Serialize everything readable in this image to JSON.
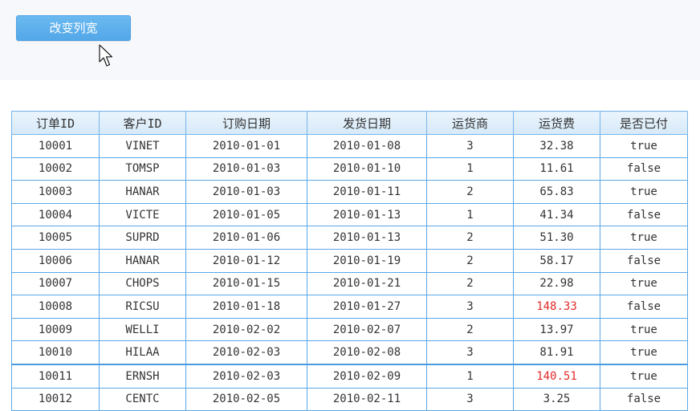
{
  "toolbar": {
    "button_label": "改变列宽"
  },
  "table": {
    "headers": [
      "订单ID",
      "客户ID",
      "订购日期",
      "发货日期",
      "运货商",
      "运货费",
      "是否已付"
    ],
    "highlight_color": "#e02a2a",
    "rows": [
      {
        "cells": [
          "10001",
          "VINET",
          "2010-01-01",
          "2010-01-08",
          "3",
          "32.38",
          "true"
        ],
        "freight_red": false
      },
      {
        "cells": [
          "10002",
          "TOMSP",
          "2010-01-03",
          "2010-01-10",
          "1",
          "11.61",
          "false"
        ],
        "freight_red": false
      },
      {
        "cells": [
          "10003",
          "HANAR",
          "2010-01-03",
          "2010-01-11",
          "2",
          "65.83",
          "true"
        ],
        "freight_red": false
      },
      {
        "cells": [
          "10004",
          "VICTE",
          "2010-01-05",
          "2010-01-13",
          "1",
          "41.34",
          "false"
        ],
        "freight_red": false
      },
      {
        "cells": [
          "10005",
          "SUPRD",
          "2010-01-06",
          "2010-01-13",
          "2",
          "51.30",
          "true"
        ],
        "freight_red": false
      },
      {
        "cells": [
          "10006",
          "HANAR",
          "2010-01-12",
          "2010-01-19",
          "2",
          "58.17",
          "false"
        ],
        "freight_red": false
      },
      {
        "cells": [
          "10007",
          "CHOPS",
          "2010-01-15",
          "2010-01-21",
          "2",
          "22.98",
          "true"
        ],
        "freight_red": false
      },
      {
        "cells": [
          "10008",
          "RICSU",
          "2010-01-18",
          "2010-01-27",
          "3",
          "148.33",
          "false"
        ],
        "freight_red": true
      },
      {
        "cells": [
          "10009",
          "WELLI",
          "2010-02-02",
          "2010-02-07",
          "2",
          "13.97",
          "true"
        ],
        "freight_red": false
      },
      {
        "cells": [
          "10010",
          "HILAA",
          "2010-02-03",
          "2010-02-08",
          "3",
          "81.91",
          "true"
        ],
        "freight_red": false
      },
      {
        "cells": [
          "10011",
          "ERNSH",
          "2010-02-03",
          "2010-02-09",
          "1",
          "140.51",
          "true"
        ],
        "freight_red": true
      },
      {
        "cells": [
          "10012",
          "CENTC",
          "2010-02-05",
          "2010-02-11",
          "3",
          "3.25",
          "false"
        ],
        "freight_red": false
      }
    ]
  },
  "icons": {
    "cursor": "mouse-pointer-icon"
  }
}
